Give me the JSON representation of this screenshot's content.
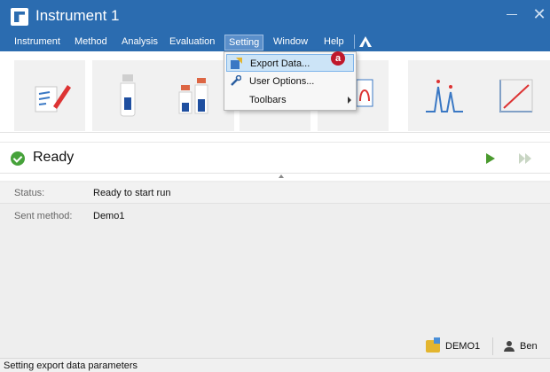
{
  "window": {
    "title": "Instrument 1"
  },
  "menu": {
    "items": [
      "Instrument",
      "Method",
      "Analysis",
      "Evaluation",
      "Setting",
      "Window",
      "Help"
    ],
    "active": "Setting"
  },
  "toolbar": {
    "tools": [
      "method-editor-tool",
      "single-vial-tool",
      "sequence-vials-tool",
      "tool-4",
      "tool-5",
      "chromatogram-tool",
      "calibration-tool"
    ]
  },
  "run_status": {
    "label": "Ready"
  },
  "info": {
    "rows": [
      {
        "key": "Status:",
        "value": "Ready to start run"
      },
      {
        "key": "Sent method:",
        "value": "Demo1"
      }
    ],
    "project": "DEMO1",
    "user": "Ben"
  },
  "dropdown": {
    "items": [
      {
        "label": "Export Data...",
        "icon": "export-icon",
        "highlighted": true
      },
      {
        "label": "User Options...",
        "icon": "wrench-icon",
        "highlighted": false
      },
      {
        "label": "Toolbars",
        "icon": "",
        "submenu": true,
        "highlighted": false
      }
    ],
    "callout": "a"
  },
  "statusbar": {
    "text": "Setting export data parameters"
  },
  "colors": {
    "titlebar": "#2b6cb0",
    "ready_check": "#46a23a",
    "highlight": "#cce4f7",
    "callout": "#c0182b"
  }
}
